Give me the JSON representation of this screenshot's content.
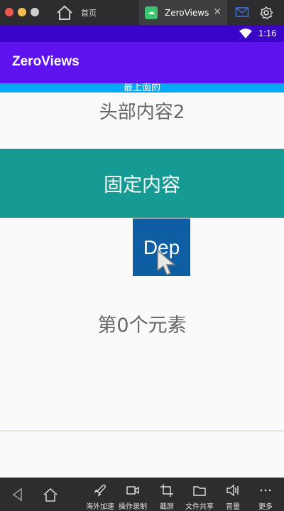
{
  "window": {
    "home_tab_label": "首页",
    "app_tab_label": "ZeroViews",
    "close_glyph": "✕",
    "app_icon_color": "#3fc170"
  },
  "status_bar": {
    "time": "1:16",
    "color": "#3a05c9"
  },
  "app_bar": {
    "title": "ZeroViews",
    "color": "#5e12ee"
  },
  "content": {
    "top_strip_text": "最上面的",
    "header_text": "头部内容2",
    "fixed_text": "固定内容",
    "dep_label": "Dep",
    "list_item_text": "第0个元素",
    "fixed_color": "#159b93",
    "dep_color": "#0e5ea3",
    "top_strip_color": "#03a9f4"
  },
  "toolbar": {
    "items": [
      {
        "label": "海外加速",
        "icon": "rocket-icon"
      },
      {
        "label": "操作录制",
        "icon": "video-icon"
      },
      {
        "label": "截屏",
        "icon": "crop-icon"
      },
      {
        "label": "文件共享",
        "icon": "folder-icon"
      },
      {
        "label": "音量",
        "icon": "speaker-icon"
      },
      {
        "label": "更多",
        "icon": "more-icon"
      }
    ]
  }
}
